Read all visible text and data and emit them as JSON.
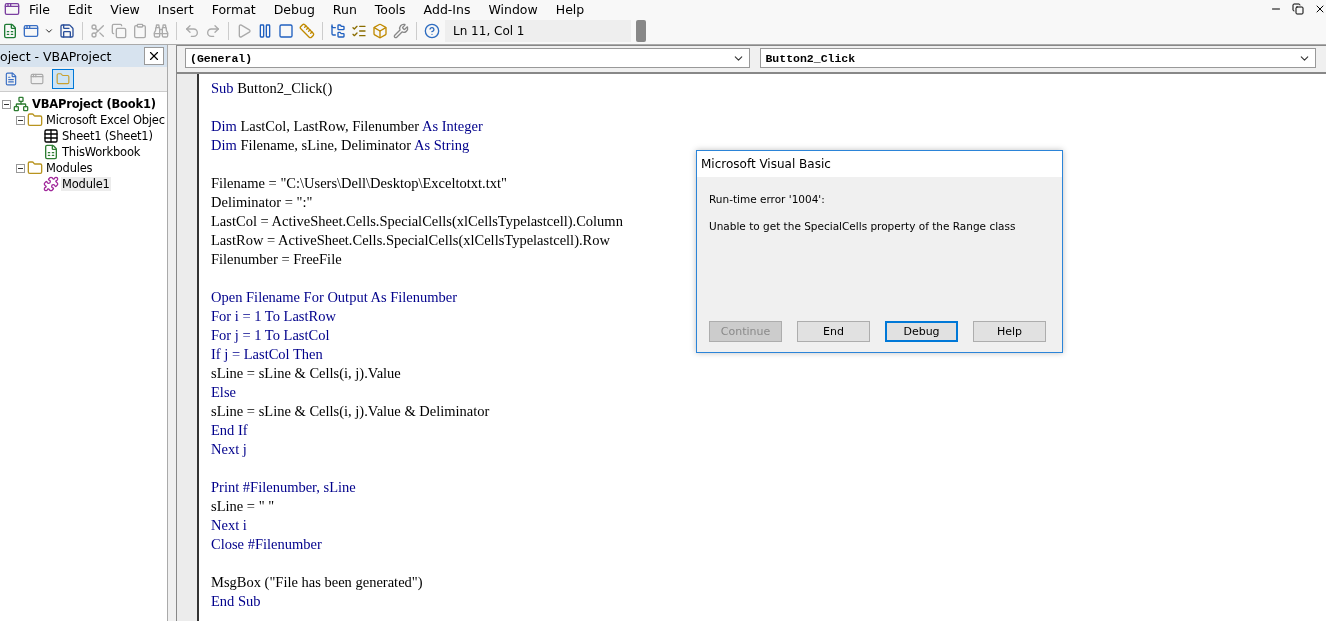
{
  "menu": [
    "File",
    "Edit",
    "View",
    "Insert",
    "Format",
    "Debug",
    "Run",
    "Tools",
    "Add-Ins",
    "Window",
    "Help"
  ],
  "toolbar": {
    "position": "Ln 11, Col 1"
  },
  "project_panel": {
    "title": "oject - VBAProject",
    "tree": [
      {
        "label": "VBAProject (Book1)",
        "kind": "project",
        "expanded": true,
        "selected": false,
        "children": [
          {
            "label": "Microsoft Excel Objec",
            "kind": "folder",
            "expanded": true,
            "selected": false,
            "children": [
              {
                "label": "Sheet1 (Sheet1)",
                "kind": "sheet",
                "selected": false
              },
              {
                "label": "ThisWorkbook",
                "kind": "workbook",
                "selected": false
              }
            ]
          },
          {
            "label": "Modules",
            "kind": "folder",
            "expanded": true,
            "selected": false,
            "children": [
              {
                "label": "Module1",
                "kind": "module",
                "selected": true
              }
            ]
          }
        ]
      }
    ]
  },
  "code_window": {
    "object_combo": "(General)",
    "procedure_combo": "Button2_Click",
    "lines": [
      {
        "kind": "code",
        "segments": [
          {
            "text": "Sub",
            "kind": "keyword"
          },
          {
            "text": " Button2_Click()",
            "kind": "plain"
          }
        ]
      },
      {
        "kind": "blank"
      },
      {
        "kind": "code",
        "segments": [
          {
            "text": "Dim",
            "kind": "keyword"
          },
          {
            "text": " LastCol, LastRow, Filenumber ",
            "kind": "plain"
          },
          {
            "text": "As Integer",
            "kind": "keyword"
          }
        ]
      },
      {
        "kind": "code",
        "segments": [
          {
            "text": "Dim",
            "kind": "keyword"
          },
          {
            "text": " Filename, sLine, Deliminator ",
            "kind": "plain"
          },
          {
            "text": "As String",
            "kind": "keyword"
          }
        ]
      },
      {
        "kind": "blank"
      },
      {
        "kind": "code",
        "segments": [
          {
            "text": "Filename = \"C:\\Users\\Dell\\Desktop\\Exceltotxt.txt\"",
            "kind": "plain"
          }
        ]
      },
      {
        "kind": "code",
        "segments": [
          {
            "text": "Deliminator = \":\"",
            "kind": "plain"
          }
        ]
      },
      {
        "kind": "code",
        "segments": [
          {
            "text": "LastCol = ActiveSheet.Cells.SpecialCells(xlCellsTypelastcell).Column",
            "kind": "plain"
          }
        ]
      },
      {
        "kind": "code",
        "segments": [
          {
            "text": "LastRow = ActiveSheet.Cells.SpecialCells(xlCellsTypelastcell).Row",
            "kind": "plain"
          }
        ]
      },
      {
        "kind": "code",
        "segments": [
          {
            "text": "Filenumber = FreeFile",
            "kind": "plain"
          }
        ]
      },
      {
        "kind": "blank"
      },
      {
        "kind": "code",
        "segments": [
          {
            "text": "Open Filename For Output As Filenumber",
            "kind": "keyword"
          }
        ]
      },
      {
        "kind": "code",
        "segments": [
          {
            "text": "For i = 1 To LastRow",
            "kind": "keyword"
          }
        ]
      },
      {
        "kind": "code",
        "segments": [
          {
            "text": "For j = 1 To LastCol",
            "kind": "keyword"
          }
        ]
      },
      {
        "kind": "code",
        "segments": [
          {
            "text": "If j = LastCol Then",
            "kind": "keyword"
          }
        ]
      },
      {
        "kind": "code",
        "segments": [
          {
            "text": "sLine = sLine & Cells(i, j).Value",
            "kind": "plain"
          }
        ]
      },
      {
        "kind": "code",
        "segments": [
          {
            "text": "Else",
            "kind": "keyword"
          }
        ]
      },
      {
        "kind": "code",
        "segments": [
          {
            "text": "sLine = sLine & Cells(i, j).Value & Deliminator",
            "kind": "plain"
          }
        ]
      },
      {
        "kind": "code",
        "segments": [
          {
            "text": "End If",
            "kind": "keyword"
          }
        ]
      },
      {
        "kind": "code",
        "segments": [
          {
            "text": "Next j",
            "kind": "keyword"
          }
        ]
      },
      {
        "kind": "blank"
      },
      {
        "kind": "code",
        "segments": [
          {
            "text": "Print #Filenumber, sLine",
            "kind": "keyword"
          }
        ]
      },
      {
        "kind": "code",
        "segments": [
          {
            "text": "sLine = \" \"",
            "kind": "plain"
          }
        ]
      },
      {
        "kind": "code",
        "segments": [
          {
            "text": "Next i",
            "kind": "keyword"
          }
        ]
      },
      {
        "kind": "code",
        "segments": [
          {
            "text": "Close #Filenumber",
            "kind": "keyword"
          }
        ]
      },
      {
        "kind": "blank"
      },
      {
        "kind": "code",
        "segments": [
          {
            "text": "MsgBox (\"File has been generated\")",
            "kind": "plain"
          }
        ]
      },
      {
        "kind": "code",
        "segments": [
          {
            "text": "End Sub",
            "kind": "keyword"
          }
        ]
      }
    ]
  },
  "dialog": {
    "title": "Microsoft Visual Basic",
    "message": [
      "Run-time error '1004':",
      "Unable to get the SpecialCells property of the Range class"
    ],
    "buttons": [
      {
        "label": "Continue",
        "disabled": true,
        "focused": false
      },
      {
        "label": "End",
        "disabled": false,
        "focused": false
      },
      {
        "label": "Debug",
        "disabled": false,
        "focused": true
      },
      {
        "label": "Help",
        "disabled": false,
        "focused": false
      }
    ]
  }
}
